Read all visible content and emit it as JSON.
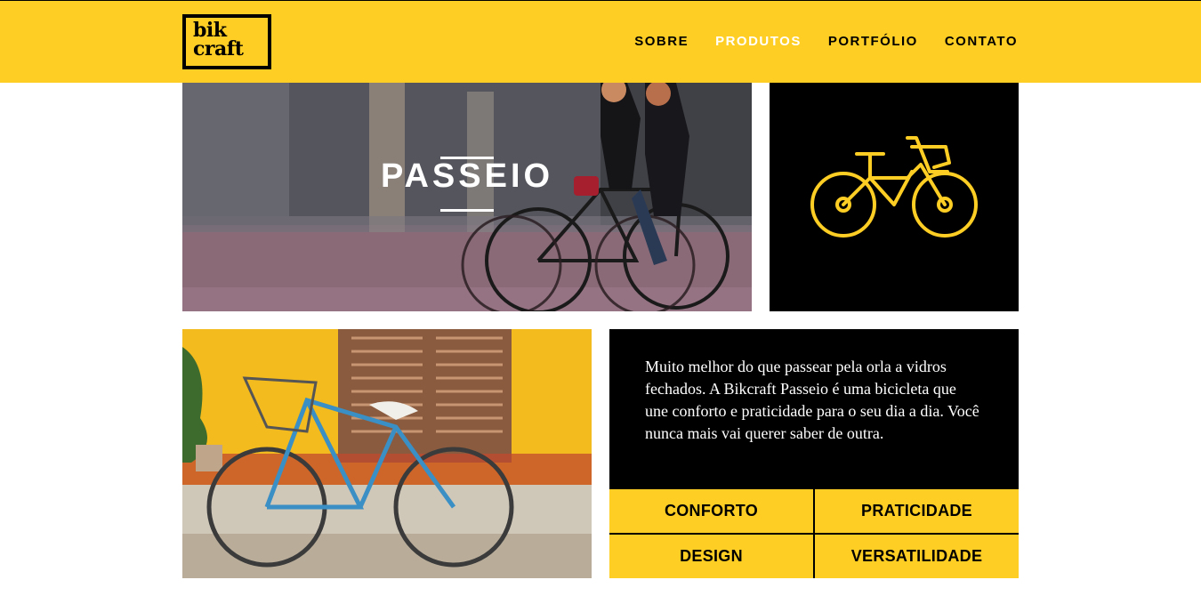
{
  "header": {
    "logo": {
      "line1": "bik",
      "line2": "craft"
    },
    "nav": [
      {
        "label": "SOBRE",
        "active": false
      },
      {
        "label": "PRODUTOS",
        "active": true
      },
      {
        "label": "PORTFÓLIO",
        "active": false
      },
      {
        "label": "CONTATO",
        "active": false
      }
    ]
  },
  "hero": {
    "title": "PASSEIO"
  },
  "product": {
    "description": "Muito melhor do que passear pela orla a vidros fechados. A Bikcraft Passeio é uma bicicleta que une conforto e praticidade para o seu dia a dia. Você nunca mais vai querer saber de outra.",
    "features": [
      "CONFORTO",
      "PRATICIDADE",
      "DESIGN",
      "VERSATILIDADE"
    ]
  },
  "colors": {
    "brand_yellow": "#FECE24",
    "black": "#000000",
    "white": "#FFFFFF"
  },
  "icons": {
    "product_icon": "bicycle-icon"
  }
}
